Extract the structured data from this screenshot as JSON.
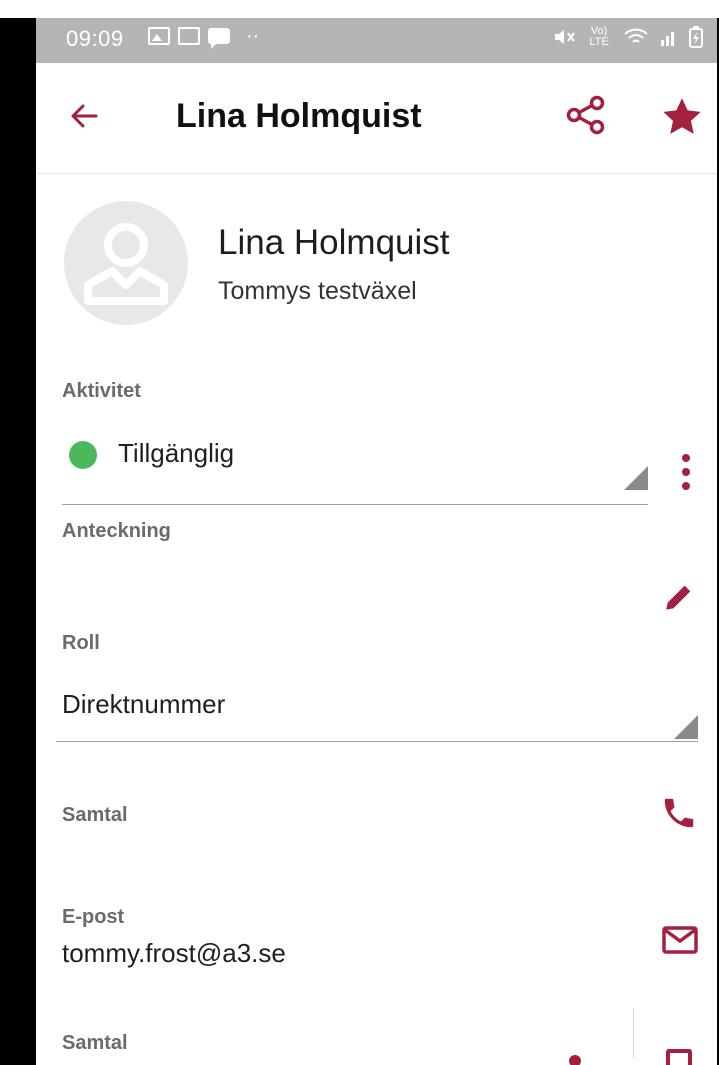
{
  "status_bar": {
    "time": "09:09",
    "right_indicators": "Vo) LTE"
  },
  "header": {
    "title": "Lina Holmquist"
  },
  "profile": {
    "name": "Lina Holmquist",
    "organization": "Tommys testväxel"
  },
  "activity": {
    "label": "Aktivitet",
    "value": "Tillgänglig",
    "status_color": "#4cb85b"
  },
  "note": {
    "label": "Anteckning"
  },
  "role": {
    "label": "Roll",
    "value": "Direktnummer"
  },
  "call": {
    "label": "Samtal"
  },
  "email": {
    "label": "E-post",
    "value": "tommy.frost@a3.se"
  },
  "call2": {
    "label": "Samtal"
  },
  "colors": {
    "accent": "#a3213f",
    "status_bar": "#b5b5b5",
    "label_gray": "#6b6b6b"
  },
  "icons": [
    "back-arrow-icon",
    "share-icon",
    "star-icon",
    "kebab-menu-icon",
    "edit-pencil-icon",
    "phone-icon",
    "mail-icon"
  ]
}
